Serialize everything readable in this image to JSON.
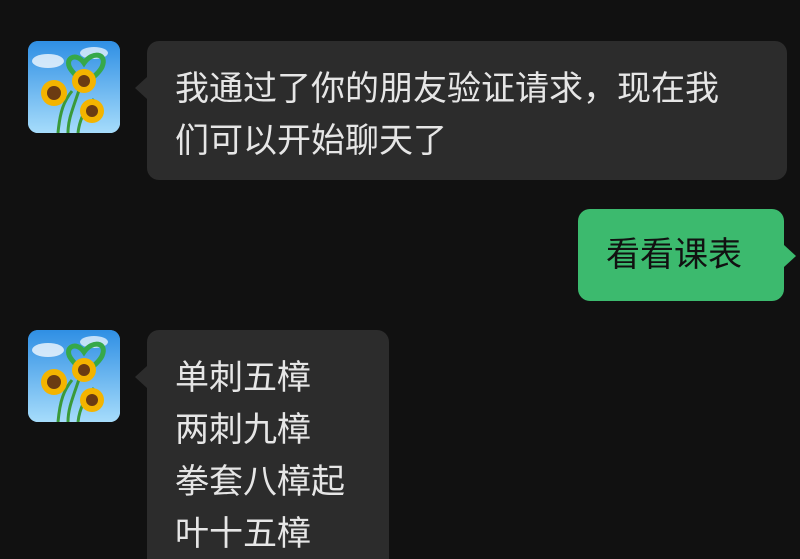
{
  "theme": {
    "background": "#111111",
    "incoming_bubble": "#2c2c2c",
    "outgoing_bubble": "#3cba6e",
    "incoming_text": "#e6e6e6",
    "outgoing_text": "#111111"
  },
  "messages": [
    {
      "direction": "incoming",
      "avatar_icon": "sunflower-avatar-icon",
      "lines": [
        "我通过了你的朋友验证请求，现在我",
        "们可以开始聊天了"
      ]
    },
    {
      "direction": "outgoing",
      "lines": [
        "看看课表"
      ]
    },
    {
      "direction": "incoming",
      "avatar_icon": "sunflower-avatar-icon",
      "lines": [
        "单刺五樟",
        "两刺九樟",
        "拳套八樟起",
        "叶十五樟"
      ]
    }
  ]
}
